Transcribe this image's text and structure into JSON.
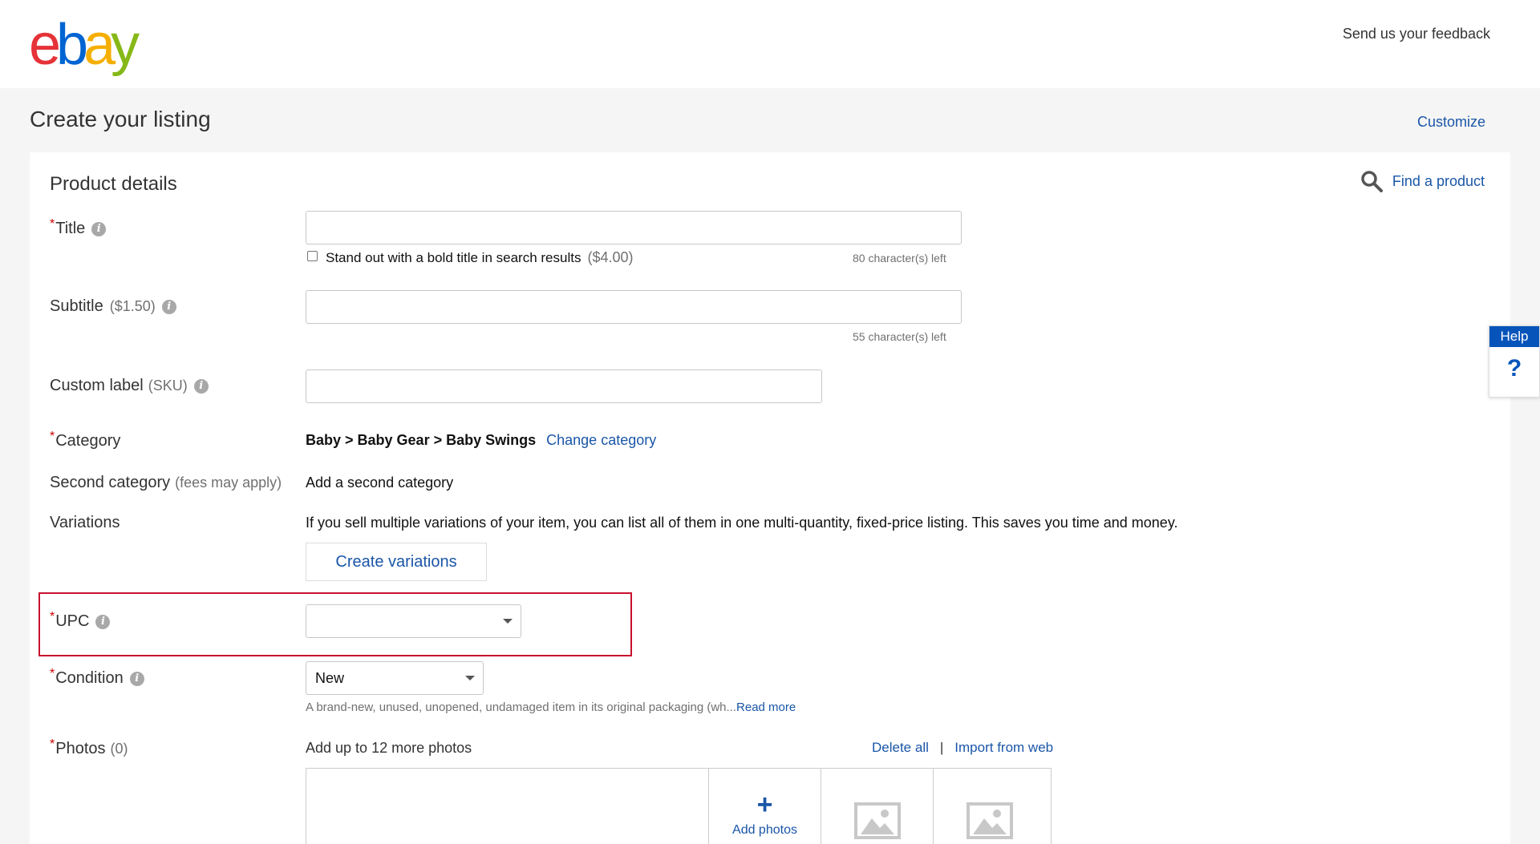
{
  "header": {
    "logo": {
      "e": "e",
      "b": "b",
      "a": "a",
      "y": "y"
    },
    "feedback_link": "Send us your feedback"
  },
  "page": {
    "title": "Create your listing",
    "customize_link": "Customize"
  },
  "product": {
    "section_title": "Product details",
    "find_product_link": "Find a product",
    "title_field": {
      "label": "Title",
      "value": "",
      "bold_option": "Stand out with a bold title in search results",
      "bold_price": "($4.00)",
      "chars_left": "80 character(s) left"
    },
    "subtitle_field": {
      "label": "Subtitle",
      "price": "($1.50)",
      "value": "",
      "chars_left": "55 character(s) left"
    },
    "custom_label": {
      "label": "Custom label",
      "suffix": "(SKU)",
      "value": ""
    },
    "category": {
      "label": "Category",
      "path": "Baby > Baby Gear > Baby Swings",
      "change_link": "Change category"
    },
    "second_category": {
      "label": "Second category",
      "suffix": "(fees may apply)",
      "add_link": "Add a second category"
    },
    "variations": {
      "label": "Variations",
      "description": "If you sell multiple variations of your item, you can list all of them in one multi-quantity, fixed-price listing. This saves you time and money.",
      "button": "Create variations"
    },
    "upc": {
      "label": "UPC",
      "value": ""
    },
    "condition": {
      "label": "Condition",
      "value": "New",
      "description": "A brand-new, unused, unopened, undamaged item in its original packaging (wh...",
      "read_more": "Read more"
    },
    "photos": {
      "label": "Photos",
      "count": "(0)",
      "hint": "Add up to 12 more photos",
      "delete_all": "Delete all",
      "separator": "|",
      "import_link": "Import from web",
      "add_photos": "Add photos",
      "add_symbol": "+"
    }
  },
  "help": {
    "label": "Help",
    "symbol": "?"
  },
  "required_mark": "*",
  "info_glyph": "i",
  "colors": {
    "link": "#1a56a8",
    "highlight_border": "#c8102e",
    "help_blue": "#0654ba"
  }
}
